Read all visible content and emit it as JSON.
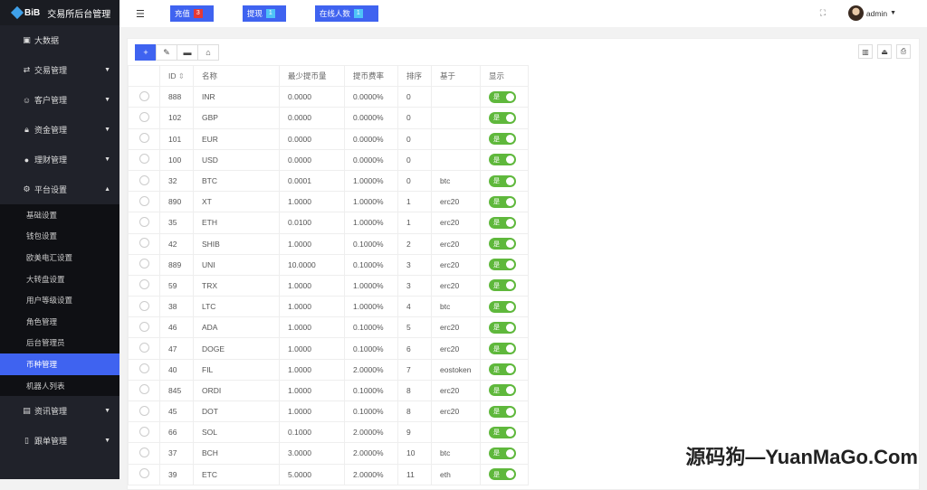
{
  "brand": {
    "logo": "BiB",
    "title": "交易所后台管理"
  },
  "sidebar": {
    "items": [
      {
        "label": "大数据",
        "icon": "chart-icon"
      },
      {
        "label": "交易管理",
        "icon": "exchange-icon",
        "arrow": "▼"
      },
      {
        "label": "客户管理",
        "icon": "users-icon",
        "arrow": "▼"
      },
      {
        "label": "资金管理",
        "icon": "lock-icon",
        "arrow": "▼"
      },
      {
        "label": "理财管理",
        "icon": "piggy-icon",
        "arrow": "▼"
      },
      {
        "label": "平台设置",
        "icon": "gear-icon",
        "arrow": "▲"
      }
    ],
    "sub": [
      "基础设置",
      "钱包设置",
      "欧美电汇设置",
      "大转盘设置",
      "用户等级设置",
      "角色管理",
      "后台管理员",
      "币种管理",
      "机器人列表"
    ],
    "active_sub": "币种管理",
    "after": [
      {
        "label": "资讯管理",
        "icon": "news-icon",
        "arrow": "▼"
      },
      {
        "label": "跟单管理",
        "icon": "doc-icon",
        "arrow": "▼"
      }
    ]
  },
  "header": {
    "buttons": [
      {
        "label": "充值",
        "badge": "3",
        "badge_color": "#e53935"
      },
      {
        "label": "提现",
        "badge": "1",
        "badge_color": "#4fc3f7"
      },
      {
        "label": "在线人数",
        "badge": "1",
        "badge_color": "#4fc3f7"
      }
    ],
    "user": "admin"
  },
  "table": {
    "headers": [
      "ID",
      "名称",
      "最少提币量",
      "提币费率",
      "排序",
      "基于",
      "显示"
    ],
    "toggle_label": "是",
    "rows": [
      [
        "888",
        "INR",
        "0.0000",
        "0.0000%",
        "0",
        ""
      ],
      [
        "102",
        "GBP",
        "0.0000",
        "0.0000%",
        "0",
        ""
      ],
      [
        "101",
        "EUR",
        "0.0000",
        "0.0000%",
        "0",
        ""
      ],
      [
        "100",
        "USD",
        "0.0000",
        "0.0000%",
        "0",
        ""
      ],
      [
        "32",
        "BTC",
        "0.0001",
        "1.0000%",
        "0",
        "btc"
      ],
      [
        "890",
        "XT",
        "1.0000",
        "1.0000%",
        "1",
        "erc20"
      ],
      [
        "35",
        "ETH",
        "0.0100",
        "1.0000%",
        "1",
        "erc20"
      ],
      [
        "42",
        "SHIB",
        "1.0000",
        "0.1000%",
        "2",
        "erc20"
      ],
      [
        "889",
        "UNI",
        "10.0000",
        "0.1000%",
        "3",
        "erc20"
      ],
      [
        "59",
        "TRX",
        "1.0000",
        "1.0000%",
        "3",
        "erc20"
      ],
      [
        "38",
        "LTC",
        "1.0000",
        "1.0000%",
        "4",
        "btc"
      ],
      [
        "46",
        "ADA",
        "1.0000",
        "0.1000%",
        "5",
        "erc20"
      ],
      [
        "47",
        "DOGE",
        "1.0000",
        "0.1000%",
        "6",
        "erc20"
      ],
      [
        "40",
        "FIL",
        "1.0000",
        "2.0000%",
        "7",
        "eostoken"
      ],
      [
        "845",
        "ORDI",
        "1.0000",
        "0.1000%",
        "8",
        "erc20"
      ],
      [
        "45",
        "DOT",
        "1.0000",
        "0.1000%",
        "8",
        "erc20"
      ],
      [
        "66",
        "SOL",
        "0.1000",
        "2.0000%",
        "9",
        ""
      ],
      [
        "37",
        "BCH",
        "3.0000",
        "2.0000%",
        "10",
        "btc"
      ],
      [
        "39",
        "ETC",
        "5.0000",
        "2.0000%",
        "11",
        "eth"
      ]
    ]
  },
  "watermark": "源码狗—YuanMaGo.Com"
}
